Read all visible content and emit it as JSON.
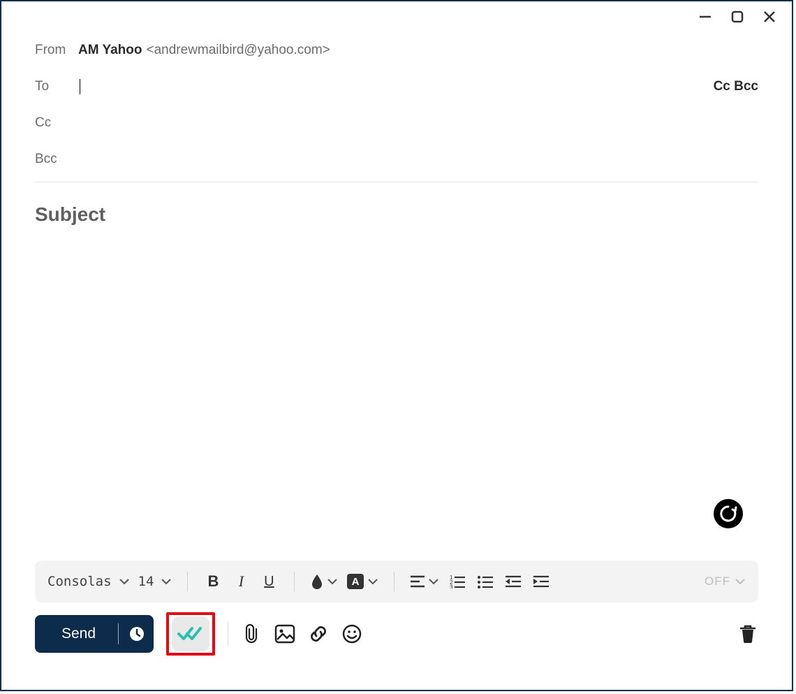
{
  "window": {
    "from_label": "From",
    "from_name": "AM Yahoo",
    "from_addr": "<andrewmailbird@yahoo.com>",
    "to_label": "To",
    "to_value": "",
    "cc_label": "Cc",
    "bcc_label": "Bcc",
    "ccbcc_toggle": "Cc Bcc",
    "subject_placeholder": "Subject"
  },
  "format": {
    "font_name": "Consolas",
    "font_size": "14",
    "off_label": "OFF"
  },
  "actions": {
    "send_label": "Send"
  }
}
